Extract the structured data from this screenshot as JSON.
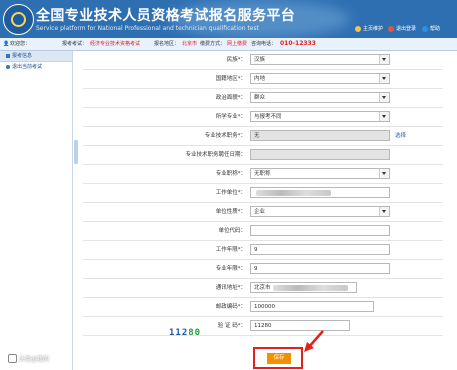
{
  "header": {
    "title_cn": "全国专业技术人员资格考试报名服务平台",
    "title_en": "Service platform for National Professional and technician qualification test",
    "links": [
      {
        "label": "主页维护",
        "icon": "home-icon",
        "color": "#f3c64a"
      },
      {
        "label": "退出登录",
        "icon": "logout-icon",
        "color": "#e8543b"
      },
      {
        "label": "帮助",
        "icon": "help-icon",
        "color": "#2e8ee0"
      }
    ]
  },
  "infobar": {
    "welcome_label": "欢迎您：",
    "exam_label": "报考考试：",
    "exam_value": "经济专业技术资格考试",
    "region_label": "报名地区：",
    "region_value": "北京市",
    "service_label": "缴费方式：",
    "service_value": "网上缴费",
    "phone_label": "咨询电话：",
    "phone_value": "010-12333"
  },
  "sidebar": {
    "header": "报考信息",
    "items": [
      {
        "label": "退出当前考试"
      }
    ]
  },
  "form": {
    "rows": [
      {
        "label": "民族*：",
        "value": "汉族",
        "type": "select"
      },
      {
        "label": "国籍地区*：",
        "value": "内地",
        "type": "select"
      },
      {
        "label": "政治面貌*：",
        "value": "群众",
        "type": "select"
      },
      {
        "label": "所学专业*：",
        "value": "与报考不同",
        "type": "select"
      },
      {
        "label": "专业技术职务*：",
        "value": "无",
        "type": "disabled",
        "link": "选择"
      },
      {
        "label": "专业技术职务聘任日期：",
        "value": "",
        "type": "disabled"
      },
      {
        "label": "专业职称*：",
        "value": "无职称",
        "type": "select"
      },
      {
        "label": "工作单位*：",
        "value": "",
        "type": "blurred"
      },
      {
        "label": "单位性质*：",
        "value": "企业",
        "type": "select"
      },
      {
        "label": "单位代码：",
        "value": "",
        "type": "text"
      },
      {
        "label": "工作年限*：",
        "value": "9",
        "type": "text"
      },
      {
        "label": "专业年限*：",
        "value": "9",
        "type": "text"
      },
      {
        "label": "通讯地址*：",
        "value": "北京市",
        "type": "addr"
      },
      {
        "label": "邮政编码*：",
        "value": "100000",
        "type": "short"
      },
      {
        "label": "验 证 码*：",
        "value": "11280",
        "type": "code"
      }
    ],
    "captcha_main": "112",
    "captcha_tail": "80",
    "save_label": "保存"
  },
  "watermark": "头条@我的"
}
